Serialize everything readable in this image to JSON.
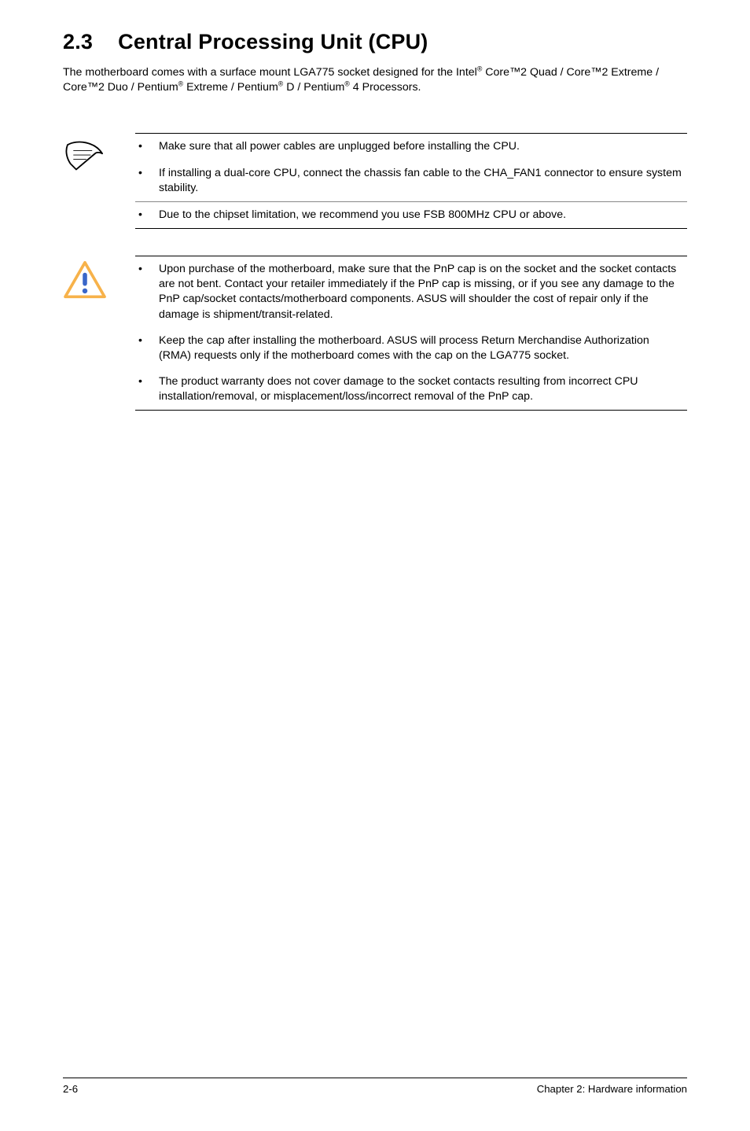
{
  "heading": {
    "number": "2.3",
    "title": "Central Processing Unit (CPU)"
  },
  "intro_html": "The motherboard comes with a surface mount LGA775 socket designed for the Intel<sup>®</sup> Core™2 Quad / Core™2 Extreme / Core™2 Duo / Pentium<sup>®</sup> Extreme / Pentium<sup>®</sup> D / Pentium<sup>®</sup> 4 Processors.",
  "note_blocks": [
    {
      "icon": "note-icon",
      "bullets": [
        "Make sure that all power cables are unplugged before installing the CPU.",
        "If installing a dual-core CPU, connect the chassis fan cable to the CHA_FAN1 connector to ensure system stability.",
        "Due to the chipset limitation, we recommend you use FSB 800MHz CPU or above."
      ]
    },
    {
      "icon": "caution-icon",
      "bullets": [
        "Upon purchase of the motherboard, make sure that the PnP cap is on the socket and the socket contacts are not bent. Contact your retailer immediately if the PnP cap is missing, or if you see any damage to the PnP cap/socket contacts/motherboard components. ASUS will shoulder the cost of repair only if the damage is shipment/transit-related.",
        "Keep the cap after installing the motherboard. ASUS will process Return Merchandise Authorization (RMA) requests only if the motherboard comes with the cap on the LGA775 socket.",
        "The product warranty does not cover damage to the socket contacts resulting from incorrect CPU installation/removal, or misplacement/loss/incorrect removal of the PnP cap."
      ]
    }
  ],
  "footer": {
    "left": "2-6",
    "right": "Chapter 2: Hardware information"
  }
}
